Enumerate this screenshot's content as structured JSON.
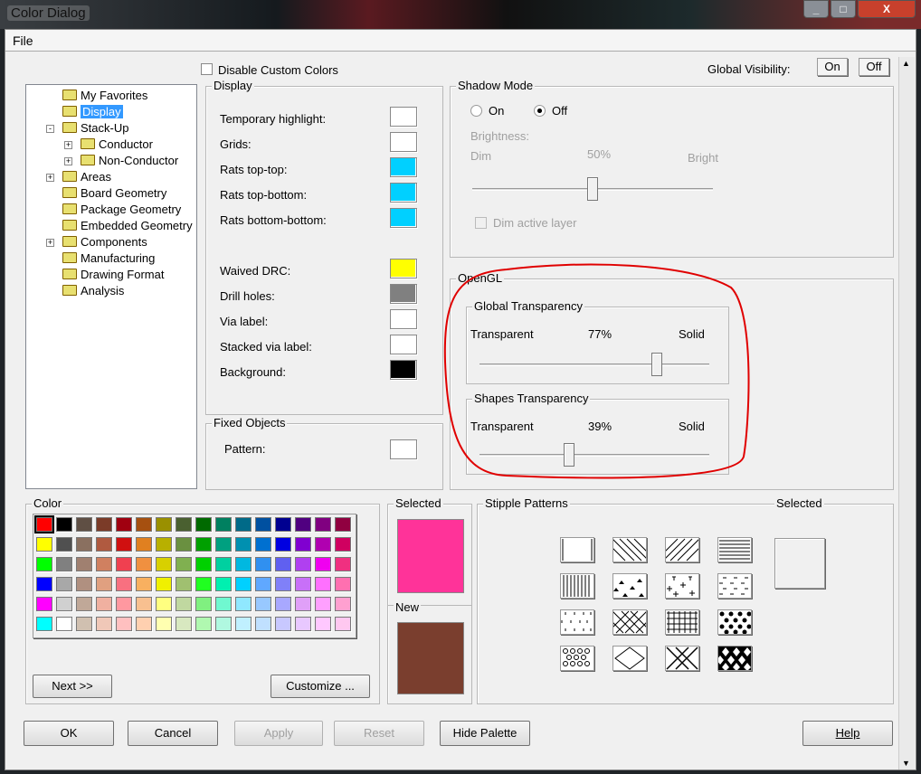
{
  "window": {
    "title": "Color Dialog",
    "minimize": "_",
    "maximize": "□",
    "close": "X"
  },
  "menu": {
    "file": "File"
  },
  "top": {
    "disable_custom_colors": "Disable Custom Colors",
    "disable_custom_colors_checked": false,
    "global_visibility": "Global Visibility:",
    "on": "On",
    "off": "Off"
  },
  "tree": {
    "items": [
      {
        "label": "My Favorites",
        "level": 0,
        "expander": ""
      },
      {
        "label": "Display",
        "level": 0,
        "expander": "",
        "selected": true
      },
      {
        "label": "Stack-Up",
        "level": 0,
        "expander": "-",
        "open": true
      },
      {
        "label": "Conductor",
        "level": 1,
        "expander": "+"
      },
      {
        "label": "Non-Conductor",
        "level": 1,
        "expander": "+"
      },
      {
        "label": "Areas",
        "level": 0,
        "expander": "+"
      },
      {
        "label": "Board Geometry",
        "level": 0,
        "expander": ""
      },
      {
        "label": "Package Geometry",
        "level": 0,
        "expander": ""
      },
      {
        "label": "Embedded Geometry",
        "level": 0,
        "expander": ""
      },
      {
        "label": "Components",
        "level": 0,
        "expander": "+"
      },
      {
        "label": "Manufacturing",
        "level": 0,
        "expander": ""
      },
      {
        "label": "Drawing Format",
        "level": 0,
        "expander": ""
      },
      {
        "label": "Analysis",
        "level": 0,
        "expander": ""
      }
    ]
  },
  "display": {
    "title": "Display",
    "items": [
      {
        "label": "Temporary highlight:",
        "color": "#ffffff"
      },
      {
        "label": "Grids:",
        "color": "#ffffff"
      },
      {
        "label": "Rats top-top:",
        "color": "#00d0ff"
      },
      {
        "label": "Rats top-bottom:",
        "color": "#00d0ff"
      },
      {
        "label": "Rats bottom-bottom:",
        "color": "#00d0ff"
      },
      {
        "label": "Waived DRC:",
        "color": "#ffff00"
      },
      {
        "label": "Drill holes:",
        "color": "#808080"
      },
      {
        "label": "Via label:",
        "color": "#ffffff"
      },
      {
        "label": "Stacked via label:",
        "color": "#ffffff"
      },
      {
        "label": "Background:",
        "color": "#000000"
      }
    ]
  },
  "fixed": {
    "title": "Fixed Objects",
    "pattern": "Pattern:"
  },
  "shadow": {
    "title": "Shadow Mode",
    "on": "On",
    "off": "Off",
    "selected": "Off",
    "brightness": "Brightness:",
    "dim": "Dim",
    "bright": "Bright",
    "value_label": "50%",
    "value": 50,
    "dim_active": "Dim active layer"
  },
  "opengl": {
    "title": "OpenGL",
    "global": {
      "title": "Global Transparency",
      "left": "Transparent",
      "right": "Solid",
      "value_label": "77%",
      "value": 77
    },
    "shapes": {
      "title": "Shapes Transparency",
      "left": "Transparent",
      "right": "Solid",
      "value_label": "39%",
      "value": 39
    },
    "annotation_color": "#e00000"
  },
  "color": {
    "title": "Color",
    "selected_index": 0,
    "palette": [
      [
        "#ff0000",
        "#000000",
        "#5f4f44",
        "#7b3b28",
        "#a00010",
        "#a65010",
        "#9a9000",
        "#4a6030",
        "#006a00",
        "#008060",
        "#006a88",
        "#0050a0",
        "#000090",
        "#500080",
        "#800080",
        "#900040"
      ],
      [
        "#ffff00",
        "#505050",
        "#8a7060",
        "#b05a40",
        "#d01010",
        "#e08020",
        "#b8b000",
        "#6a9040",
        "#00a000",
        "#00a080",
        "#0090b0",
        "#0070d0",
        "#0000e0",
        "#8000d0",
        "#b000b0",
        "#d00060"
      ],
      [
        "#00ff00",
        "#808080",
        "#a08070",
        "#d08060",
        "#f04050",
        "#f09040",
        "#d8d000",
        "#80b050",
        "#00d000",
        "#00d0a0",
        "#00b8e0",
        "#3090f0",
        "#6060f0",
        "#b040f0",
        "#f000f0",
        "#f03080"
      ],
      [
        "#0000ff",
        "#a8a8a8",
        "#b09080",
        "#e0a080",
        "#f87080",
        "#f8b060",
        "#f0f000",
        "#a0c070",
        "#20ff20",
        "#00f0b0",
        "#00d0ff",
        "#60a8ff",
        "#8080f8",
        "#c870f8",
        "#ff70ff",
        "#ff70b0"
      ],
      [
        "#ff00ff",
        "#d0d0d0",
        "#c0a898",
        "#f0b0a0",
        "#ff98a0",
        "#f8c090",
        "#ffff80",
        "#c0d8a0",
        "#80f080",
        "#70f8d0",
        "#90e8ff",
        "#98c8ff",
        "#a8a8ff",
        "#e0a0f8",
        "#ffa0ff",
        "#ffa0d0"
      ],
      [
        "#00ffff",
        "#ffffff",
        "#d0c0b0",
        "#f0c8b8",
        "#ffc0c0",
        "#ffd0b0",
        "#ffffb0",
        "#d8e8c0",
        "#b0f8b0",
        "#b0f8e0",
        "#c0f0ff",
        "#c0e0ff",
        "#c8c8ff",
        "#e8c8ff",
        "#ffc8ff",
        "#ffc8f0"
      ]
    ],
    "next": "Next >>",
    "customize": "Customize ..."
  },
  "selected": {
    "title": "Selected",
    "color": "#ff3399",
    "new_title": "New",
    "new_color": "#7a3e2e"
  },
  "stipple": {
    "title": "Stipple Patterns",
    "selected_title": "Selected",
    "patterns": [
      "solid-border",
      "diag-back",
      "diag-fwd",
      "horizontal",
      "vertical",
      "triangles",
      "crosses",
      "dashes",
      "ticks",
      "diag-cross",
      "grid",
      "dots-dense",
      "circles",
      "diamond",
      "x-diamond",
      "checker-diamond"
    ]
  },
  "buttons": {
    "ok": "OK",
    "cancel": "Cancel",
    "apply": "Apply",
    "reset": "Reset",
    "hide_palette": "Hide Palette",
    "help": "Help"
  }
}
